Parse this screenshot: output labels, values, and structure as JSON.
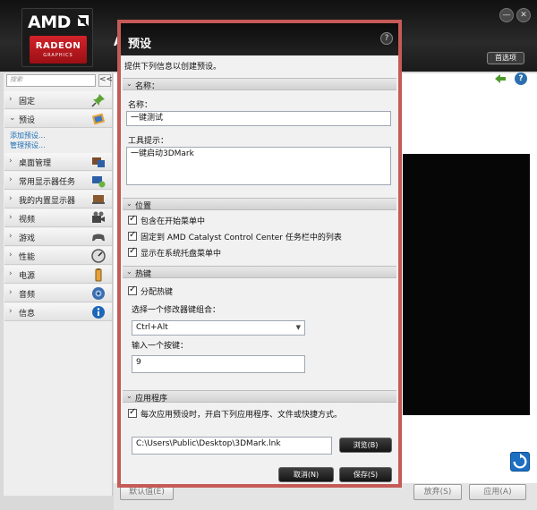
{
  "app": {
    "logo_brand": "AMD",
    "logo_product": "RADEON",
    "logo_sub": "GRAPHICS",
    "title_partial": "A",
    "preferences_label": "首选项"
  },
  "window_controls": {
    "minimize": "—",
    "close": "✕"
  },
  "sidebar": {
    "search_placeholder": "搜索",
    "collapse_label": "<<",
    "items": [
      {
        "label": "固定",
        "icon": "pin-icon"
      },
      {
        "label": "预设",
        "icon": "preset-icon",
        "expanded": true
      },
      {
        "label": "桌面管理",
        "icon": "desktop-management-icon"
      },
      {
        "label": "常用显示器任务",
        "icon": "display-tasks-icon"
      },
      {
        "label": "我的内置显示器",
        "icon": "builtin-display-icon"
      },
      {
        "label": "视频",
        "icon": "video-icon"
      },
      {
        "label": "游戏",
        "icon": "gaming-icon"
      },
      {
        "label": "性能",
        "icon": "performance-icon"
      },
      {
        "label": "电源",
        "icon": "power-icon"
      },
      {
        "label": "音频",
        "icon": "audio-icon"
      },
      {
        "label": "信息",
        "icon": "info-icon"
      }
    ],
    "sub_links": [
      "添加预设...",
      "管理预设..."
    ]
  },
  "dialog": {
    "title": "预设",
    "help": "?",
    "subtitle": "提供下列信息以创建预设。",
    "sections": {
      "name": {
        "header": "名称：",
        "name_label": "名称：",
        "name_value": "一键测试",
        "tooltip_label": "工具提示：",
        "tooltip_value": "一键启动3DMark"
      },
      "location": {
        "header": "位置",
        "options": [
          {
            "label": "包含在开始菜单中",
            "checked": true
          },
          {
            "label": "固定到 AMD Catalyst Control Center 任务栏中的列表",
            "checked": true
          },
          {
            "label": "显示在系统托盘菜单中",
            "checked": true
          }
        ]
      },
      "hotkey": {
        "header": "热键",
        "assign_label": "分配热键",
        "assign_checked": true,
        "modifier_label": "选择一个修改器键组合：",
        "modifier_value": "Ctrl+Alt",
        "key_label": "输入一个按键：",
        "key_value": "9"
      },
      "application": {
        "header": "应用程序",
        "run_label": "每次应用预设时，开启下列应用程序、文件或快捷方式。",
        "run_checked": true,
        "path_value": "C:\\Users\\Public\\Desktop\\3DMark.lnk",
        "browse_label": "浏览(B)"
      }
    },
    "cancel_label": "取消(N)",
    "save_label": "保存(S)"
  },
  "background": {
    "default_button": "默认值(E)",
    "discard_button": "放弃(S)",
    "apply_button": "应用(A)"
  },
  "colors": {
    "highlight_border": "#c55a57",
    "header_black": "#111111",
    "link_blue": "#1a6fb4"
  }
}
